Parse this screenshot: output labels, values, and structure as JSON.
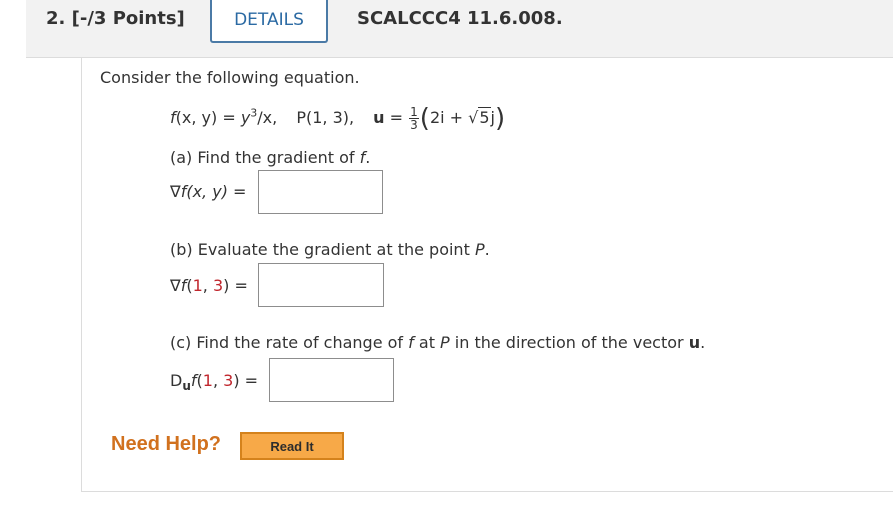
{
  "header": {
    "question_number": "2. [-/3 Points]",
    "details_label": "DETAILS",
    "problem_code": "SCALCCC4 11.6.008."
  },
  "problem": {
    "intro": "Consider the following equation.",
    "equation": {
      "f_lhs": "f",
      "f_args": "(x, y) = ",
      "y": "y",
      "exp": "3",
      "slash_x": "/x,",
      "point_label": "P(1, 3),",
      "u_label": "u",
      "u_eq": " = ",
      "frac_num": "1",
      "frac_den": "3",
      "open_paren": "(",
      "term1": "2i + ",
      "sqrt_symbol": "√",
      "sqrt_arg": "5",
      "term2": "j",
      "close_paren": ")"
    },
    "part_a": {
      "prompt_prefix": "(a) Find the gradient of ",
      "prompt_f": "f",
      "prompt_suffix": ".",
      "label_nabla": "∇",
      "label_f": "f",
      "label_args": "(x, y)",
      "label_eq": " = "
    },
    "part_b": {
      "prompt_prefix": "(b) Evaluate the gradient at the point ",
      "prompt_p": "P",
      "prompt_suffix": ".",
      "label_nabla": "∇",
      "label_f": "f",
      "label_open": "(",
      "label_n1": "1",
      "label_comma": ", ",
      "label_n2": "3",
      "label_close": ")",
      "label_eq": " = "
    },
    "part_c": {
      "prompt_prefix": "(c) Find the rate of change of ",
      "prompt_f": "f",
      "prompt_mid": " at ",
      "prompt_p": "P",
      "prompt_mid2": " in the direction of the vector ",
      "prompt_u": "u",
      "prompt_suffix": ".",
      "label_d": "D",
      "label_sub": "u",
      "label_f": "f",
      "label_open": "(",
      "label_n1": "1",
      "label_comma": ", ",
      "label_n2": "3",
      "label_close": ")",
      "label_eq": " = "
    }
  },
  "help": {
    "need_help": "Need Help?",
    "read_it": "Read It"
  },
  "colors": {
    "accent_blue": "#2b6aa3",
    "number_red": "#c0262d",
    "help_orange": "#d1711e",
    "button_orange": "#f7a948"
  }
}
